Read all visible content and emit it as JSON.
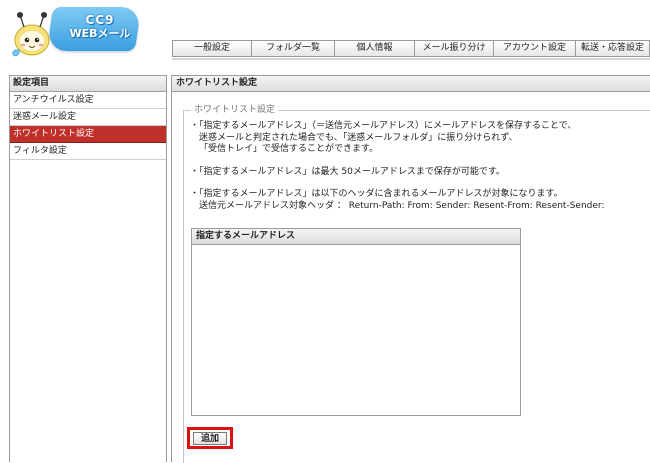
{
  "logo": {
    "line1": "CC9",
    "line2": "WEBメール",
    "mascot_icon": "mascot-icon"
  },
  "tabs": [
    {
      "label": "一般設定"
    },
    {
      "label": "フォルダ一覧"
    },
    {
      "label": "個人情報"
    },
    {
      "label": "メール振り分け"
    },
    {
      "label": "アカウント設定"
    },
    {
      "label": "転送・応答設定"
    }
  ],
  "sidebar": {
    "title": "設定項目",
    "items": [
      {
        "label": "アンチウイルス設定",
        "active": false
      },
      {
        "label": "迷惑メール設定",
        "active": false
      },
      {
        "label": "ホワイトリスト設定",
        "active": true
      },
      {
        "label": "フィルタ設定",
        "active": false
      }
    ]
  },
  "main": {
    "title": "ホワイトリスト設定",
    "legend": "ホワイトリスト設定",
    "notes": [
      {
        "lines": [
          "・「指定するメールアドレス」（＝送信元メールアドレス）にメールアドレスを保存することで、",
          "迷惑メールと判定された場合でも、「迷惑メールフォルダ」に振り分けられず、",
          "「受信トレイ」で受信することができます。"
        ]
      },
      {
        "lines": [
          "・「指定するメールアドレス」は最大 50メールアドレスまで保存が可能です。"
        ]
      },
      {
        "lines": [
          "・「指定するメールアドレス」は以下のヘッダに含まれるメールアドレスが対象になります。",
          "送信元メールアドレス対象ヘッダ ： Return-Path: From: Sender: Resent-From: Resent-Sender:"
        ]
      }
    ],
    "address_header": "指定するメールアドレス",
    "add_button": "追加"
  },
  "colors": {
    "active_item": "#c0302a",
    "highlight_border": "#e01010",
    "logo_blue": "#3a9fe0"
  }
}
